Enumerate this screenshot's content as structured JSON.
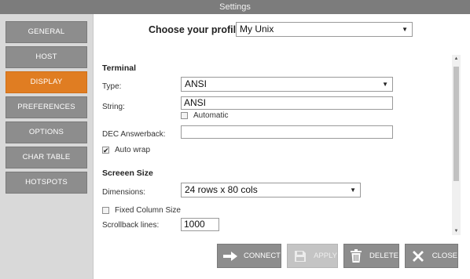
{
  "window": {
    "title": "Settings"
  },
  "sidebar": {
    "items": [
      {
        "label": "GENERAL"
      },
      {
        "label": "HOST"
      },
      {
        "label": "DISPLAY"
      },
      {
        "label": "PREFERENCES"
      },
      {
        "label": "OPTIONS"
      },
      {
        "label": "CHAR TABLE"
      },
      {
        "label": "HOTSPOTS"
      }
    ],
    "active": "DISPLAY",
    "active_color": "#e07d22"
  },
  "profile": {
    "label": "Choose your profile:",
    "value": "My Unix"
  },
  "terminal": {
    "section_title": "Terminal",
    "type_label": "Type:",
    "type_value": "ANSI",
    "string_label": "String:",
    "string_value": "ANSI",
    "automatic_label": "Automatic",
    "automatic_checked": false,
    "dec_label": "DEC Answerback:",
    "dec_value": "",
    "autowrap_label": "Auto wrap",
    "autowrap_checked": true
  },
  "screen_size": {
    "section_title": "Screeen Size",
    "dimensions_label": "Dimensions:",
    "dimensions_value": "24 rows x 80 cols",
    "fixed_column_label": "Fixed Column Size",
    "fixed_column_checked": false,
    "scrollback_label": "Scrollback lines:",
    "scrollback_value": "1000"
  },
  "buttons": {
    "connect": "CONNECT",
    "apply": "APPLY",
    "delete": "DELETE",
    "close": "CLOSE"
  },
  "icons": {
    "connect": "arrow-right-icon",
    "apply": "floppy-disk-icon",
    "delete": "trash-icon",
    "close": "close-icon"
  }
}
